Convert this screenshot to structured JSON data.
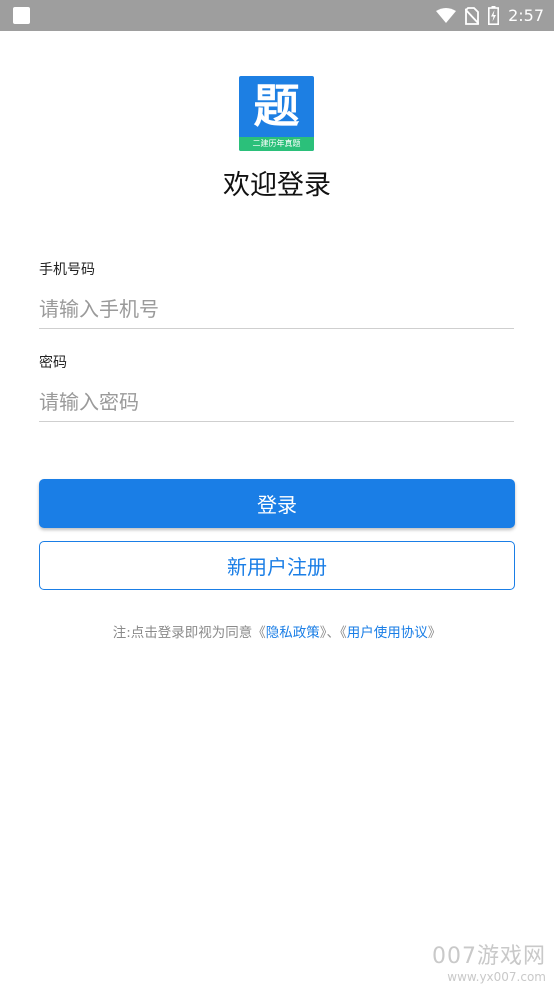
{
  "status_bar": {
    "time": "2:57",
    "icons": [
      "wifi-icon",
      "no-sim-icon",
      "battery-charging-icon"
    ],
    "colors": {
      "background": "#9e9e9e",
      "foreground": "#ffffff"
    }
  },
  "logo": {
    "character": "题",
    "subtitle": "二建历年真题",
    "colors": {
      "background": "#1d7fe3",
      "band": "#2bc07a"
    }
  },
  "title": "欢迎登录",
  "phone_field": {
    "label": "手机号码",
    "placeholder": "请输入手机号",
    "value": ""
  },
  "password_field": {
    "label": "密码",
    "placeholder": "请输入密码",
    "value": ""
  },
  "login_button": {
    "label": "登录"
  },
  "register_button": {
    "label": "新用户注册"
  },
  "agreement": {
    "prefix": "注:点击登录即视为同意《",
    "privacy_link": "隐私政策",
    "separator": "》、《",
    "terms_link": "用户使用协议",
    "suffix": "》"
  },
  "watermark": {
    "text": "007游戏网",
    "url": "www.yx007.com"
  },
  "colors": {
    "accent": "#1a7ee6",
    "placeholder": "#9a9a9a",
    "divider": "#cfcfcf"
  }
}
